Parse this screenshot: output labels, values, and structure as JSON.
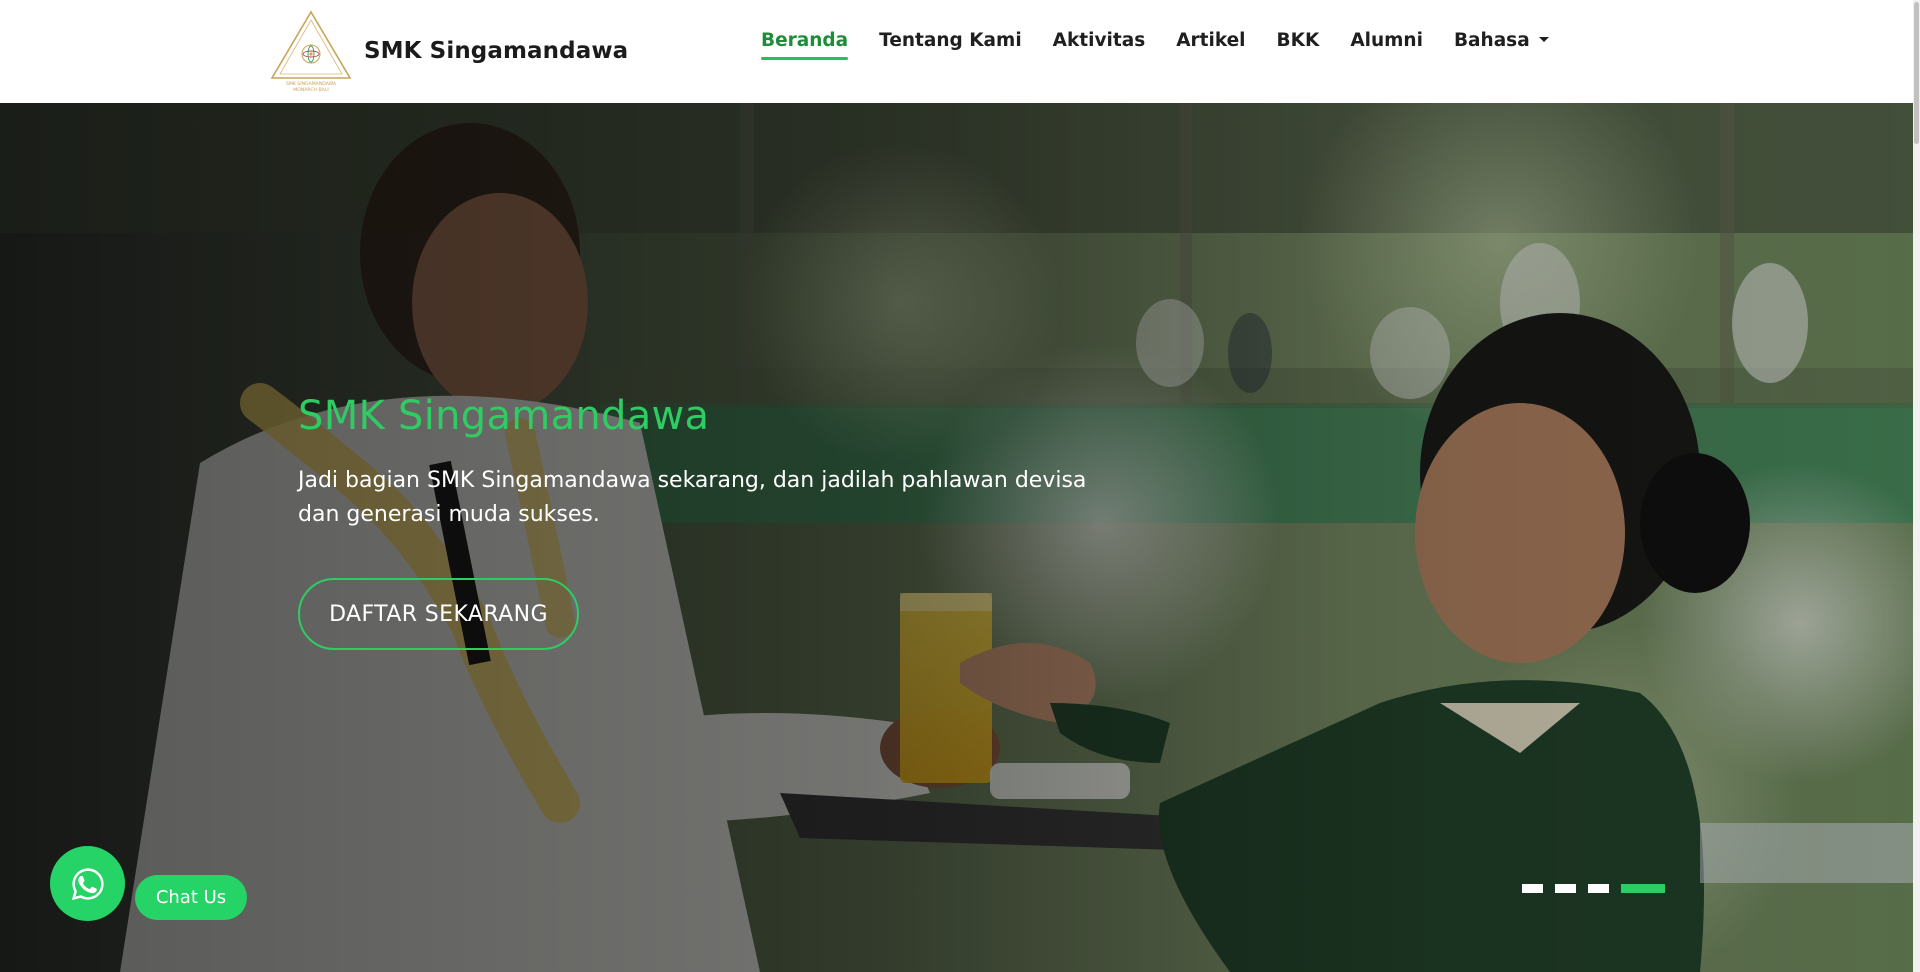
{
  "header": {
    "brand_name": "SMK Singamandawa",
    "logo_caption_line1": "SMK SINGAMANDAWA",
    "logo_caption_line2": "MONARCH BALI",
    "nav": [
      {
        "label": "Beranda",
        "active": true
      },
      {
        "label": "Tentang Kami",
        "active": false
      },
      {
        "label": "Aktivitas",
        "active": false
      },
      {
        "label": "Artikel",
        "active": false
      },
      {
        "label": "BKK",
        "active": false
      },
      {
        "label": "Alumni",
        "active": false
      },
      {
        "label": "Bahasa",
        "active": false,
        "dropdown": true
      }
    ]
  },
  "hero": {
    "title": "SMK Singamandawa",
    "subtitle_line1": "Jadi bagian SMK Singamandawa sekarang, dan jadilah pahlawan devisa",
    "subtitle_line2": "dan generasi muda sukses.",
    "cta_label": "DAFTAR SEKARANG",
    "slides_total": 4,
    "active_slide": 4
  },
  "chat": {
    "icon": "whatsapp-icon",
    "label": "Chat Us"
  },
  "colors": {
    "accent_green": "#2fcb63",
    "whatsapp_green": "#25d366",
    "nav_text": "#1f1f1f"
  }
}
